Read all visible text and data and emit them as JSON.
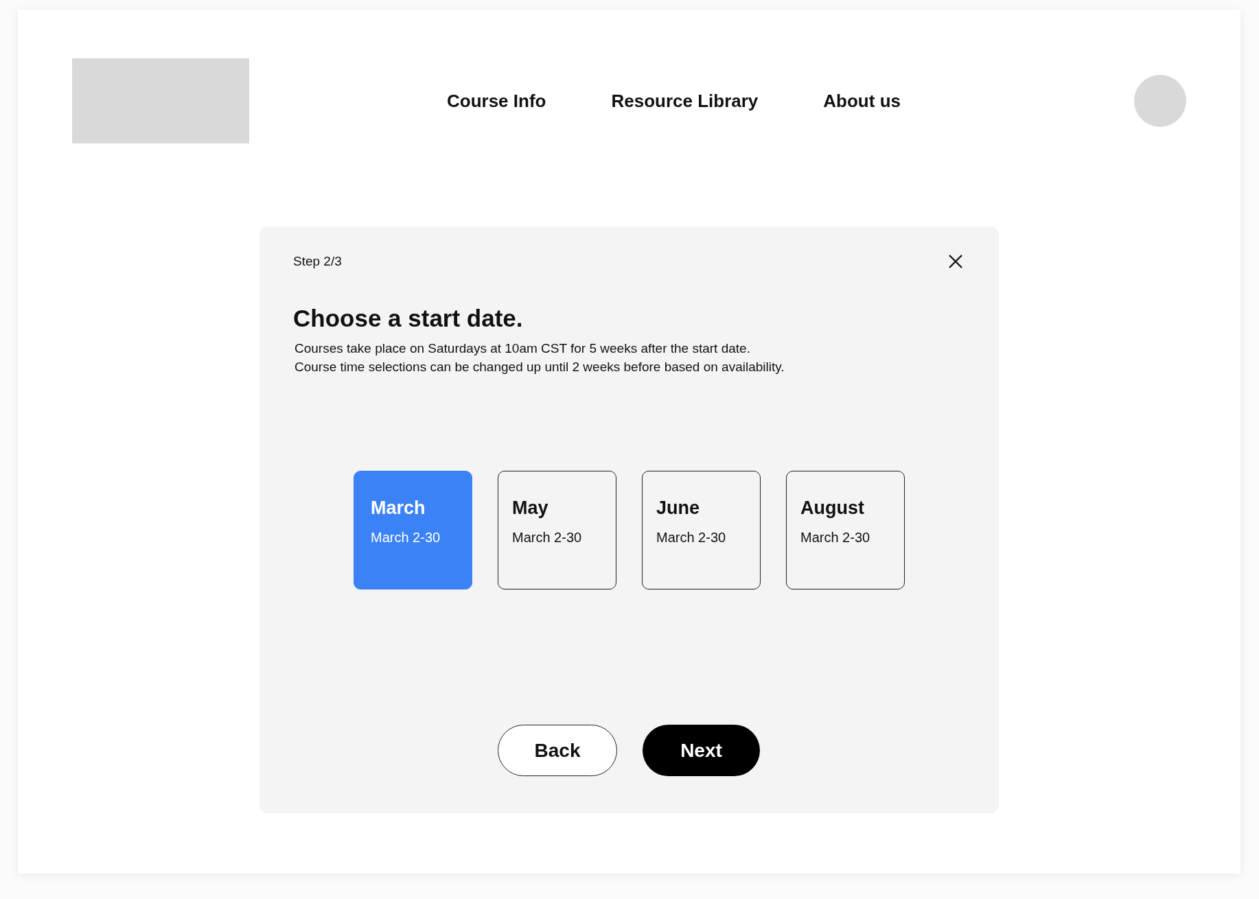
{
  "nav": {
    "items": [
      {
        "label": "Course Info"
      },
      {
        "label": "Resource Library"
      },
      {
        "label": "About us"
      }
    ]
  },
  "modal": {
    "step": "Step 2/3",
    "title": "Choose a start date.",
    "description": [
      "Courses take place on Saturdays at 10am CST for 5 weeks after the start date.",
      "Course time selections can be changed up until 2 weeks before based on availability."
    ],
    "options": [
      {
        "month": "March",
        "dates": "March 2-30",
        "selected": true
      },
      {
        "month": "May",
        "dates": "March 2-30",
        "selected": false
      },
      {
        "month": "June",
        "dates": "March 2-30",
        "selected": false
      },
      {
        "month": "August",
        "dates": "March 2-30",
        "selected": false
      }
    ],
    "buttons": [
      {
        "label": "Back",
        "kind": "secondary"
      },
      {
        "label": "Next",
        "kind": "primary"
      }
    ]
  }
}
